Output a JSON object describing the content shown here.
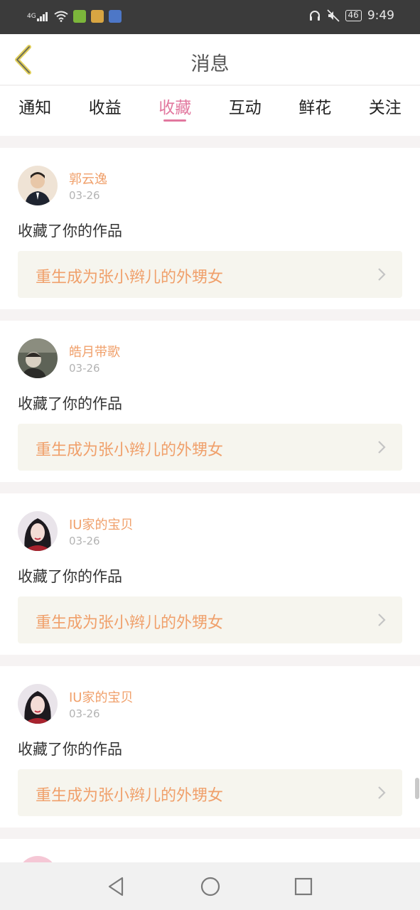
{
  "status_bar": {
    "network": "4G",
    "battery": "46",
    "time": "9:49"
  },
  "header": {
    "title": "消息"
  },
  "tabs": [
    {
      "label": "通知",
      "active": false
    },
    {
      "label": "收益",
      "active": false
    },
    {
      "label": "收藏",
      "active": true
    },
    {
      "label": "互动",
      "active": false
    },
    {
      "label": "鲜花",
      "active": false
    },
    {
      "label": "关注",
      "active": false
    }
  ],
  "items": [
    {
      "user": "郭云逸",
      "date": "03-26",
      "action": "收藏了你的作品",
      "work": "重生成为张小辫儿的外甥女"
    },
    {
      "user": "皓月带歌",
      "date": "03-26",
      "action": "收藏了你的作品",
      "work": "重生成为张小辫儿的外甥女"
    },
    {
      "user": "IU家的宝贝",
      "date": "03-26",
      "action": "收藏了你的作品",
      "work": "重生成为张小辫儿的外甥女"
    },
    {
      "user": "IU家的宝贝",
      "date": "03-26",
      "action": "收藏了你的作品",
      "work": "重生成为张小辫儿的外甥女"
    }
  ],
  "colors": {
    "accent": "#e2789f",
    "orange": "#f0a06b",
    "card_link_bg": "#f6f5ee"
  }
}
